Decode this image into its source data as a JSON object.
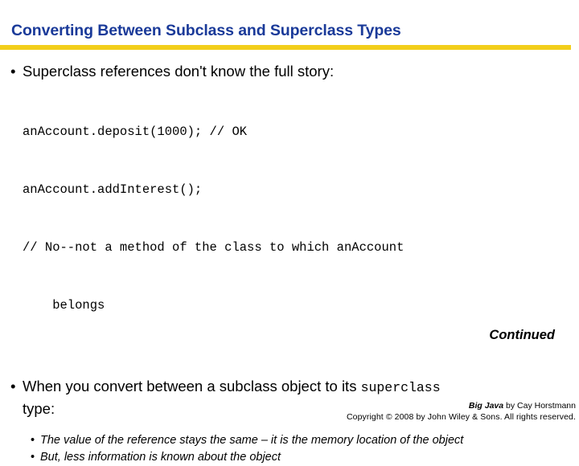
{
  "slide": {
    "title": "Converting Between Subclass and Superclass Types",
    "title_color": "#1a3a99",
    "rule_color": "#f2ce1b",
    "bullet_marker": "•",
    "bullet1": {
      "text": "Superclass references don't know the full story:",
      "code": [
        "anAccount.deposit(1000); // OK",
        "anAccount.addInterest();",
        "// No--not a method of the class to which anAccount",
        "    belongs"
      ]
    },
    "bullet2": {
      "text_before": "When you convert between a subclass object to its ",
      "mono_term": "superclass",
      "text_after": "type:",
      "sub_bullets": [
        "The value of the reference stays the same – it is the memory location of the object",
        "But, less information is known about the object"
      ]
    },
    "continued": "Continued",
    "footer": {
      "book": "Big Java",
      "byline": " by Cay Horstmann",
      "copyright": "Copyright © 2008 by John Wiley & Sons.  All rights reserved."
    }
  }
}
